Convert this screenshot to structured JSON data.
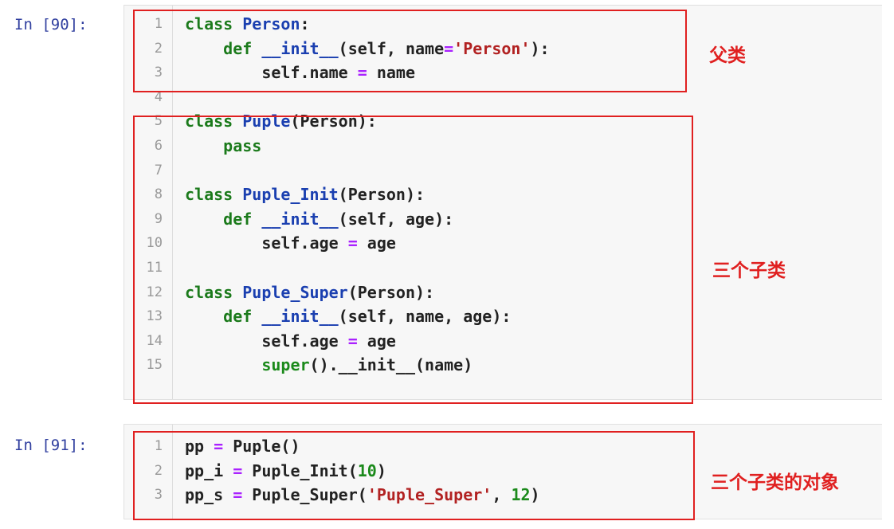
{
  "cells": [
    {
      "prompt": "In [90]:",
      "lines": [
        {
          "n": "1",
          "tokens": [
            [
              "kw",
              "class "
            ],
            [
              "cls",
              "Person"
            ],
            [
              "plain",
              ":"
            ]
          ]
        },
        {
          "n": "2",
          "tokens": [
            [
              "plain",
              "    "
            ],
            [
              "def",
              "def "
            ],
            [
              "fn",
              "__init__"
            ],
            [
              "plain",
              "(self, name"
            ],
            [
              "op",
              "="
            ],
            [
              "str",
              "'Person'"
            ],
            [
              "plain",
              "):"
            ]
          ]
        },
        {
          "n": "3",
          "tokens": [
            [
              "plain",
              "        self.name "
            ],
            [
              "op",
              "="
            ],
            [
              "plain",
              " name"
            ]
          ]
        },
        {
          "n": "4",
          "tokens": []
        },
        {
          "n": "5",
          "tokens": [
            [
              "kw",
              "class "
            ],
            [
              "cls",
              "Puple"
            ],
            [
              "plain",
              "(Person):"
            ]
          ]
        },
        {
          "n": "6",
          "tokens": [
            [
              "plain",
              "    "
            ],
            [
              "kw",
              "pass"
            ]
          ]
        },
        {
          "n": "7",
          "tokens": []
        },
        {
          "n": "8",
          "tokens": [
            [
              "kw",
              "class "
            ],
            [
              "cls",
              "Puple_Init"
            ],
            [
              "plain",
              "(Person):"
            ]
          ]
        },
        {
          "n": "9",
          "tokens": [
            [
              "plain",
              "    "
            ],
            [
              "def",
              "def "
            ],
            [
              "fn",
              "__init__"
            ],
            [
              "plain",
              "(self, age):"
            ]
          ]
        },
        {
          "n": "10",
          "tokens": [
            [
              "plain",
              "        self.age "
            ],
            [
              "op",
              "="
            ],
            [
              "plain",
              " age"
            ]
          ]
        },
        {
          "n": "11",
          "tokens": []
        },
        {
          "n": "12",
          "tokens": [
            [
              "kw",
              "class "
            ],
            [
              "cls",
              "Puple_Super"
            ],
            [
              "plain",
              "(Person):"
            ]
          ]
        },
        {
          "n": "13",
          "tokens": [
            [
              "plain",
              "    "
            ],
            [
              "def",
              "def "
            ],
            [
              "fn",
              "__init__"
            ],
            [
              "plain",
              "(self, name, age):"
            ]
          ]
        },
        {
          "n": "14",
          "tokens": [
            [
              "plain",
              "        self.age "
            ],
            [
              "op",
              "="
            ],
            [
              "plain",
              " age"
            ]
          ]
        },
        {
          "n": "15",
          "tokens": [
            [
              "plain",
              "        "
            ],
            [
              "builtin",
              "super"
            ],
            [
              "plain",
              "()."
            ],
            [
              "plain",
              "__init__"
            ],
            [
              "plain",
              "(name)"
            ]
          ]
        }
      ]
    },
    {
      "prompt": "In [91]:",
      "lines": [
        {
          "n": "1",
          "tokens": [
            [
              "plain",
              "pp "
            ],
            [
              "op",
              "="
            ],
            [
              "plain",
              " Puple()"
            ]
          ]
        },
        {
          "n": "2",
          "tokens": [
            [
              "plain",
              "pp_i "
            ],
            [
              "op",
              "="
            ],
            [
              "plain",
              " Puple_Init("
            ],
            [
              "num",
              "10"
            ],
            [
              "plain",
              ")"
            ]
          ]
        },
        {
          "n": "3",
          "tokens": [
            [
              "plain",
              "pp_s "
            ],
            [
              "op",
              "="
            ],
            [
              "plain",
              " Puple_Super("
            ],
            [
              "str",
              "'Puple_Super'"
            ],
            [
              "plain",
              ", "
            ],
            [
              "num",
              "12"
            ],
            [
              "plain",
              ")"
            ]
          ]
        }
      ]
    }
  ],
  "annotations": {
    "parent": "父类",
    "children": "三个子类",
    "objects": "三个子类的对象"
  },
  "colors": {
    "annotation": "#e02020",
    "keyword": "#1b7a1b",
    "classname": "#1a3fb0",
    "string": "#b22222",
    "operator": "#aa22ff",
    "prompt": "#303f9f"
  }
}
